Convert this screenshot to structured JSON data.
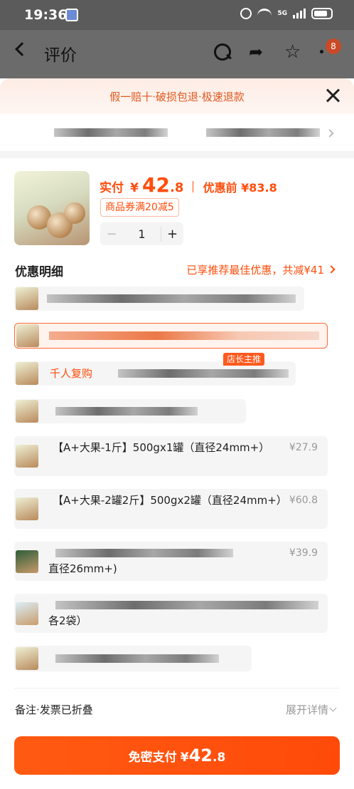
{
  "status_bar": {
    "time": "19:36",
    "network": "5G"
  },
  "header": {
    "title": "评价",
    "badge_count": "8"
  },
  "sheet": {
    "promise_text": "假一赔十·破损包退·极速退款",
    "product": {
      "price_label": "实付",
      "price_yen": "¥",
      "price_int": "42",
      "price_dec": ".8",
      "original_price": "优惠前 ¥83.8",
      "coupon": "商品券满20减5",
      "stepper_minus": "−",
      "quantity": "1",
      "stepper_plus": "+"
    },
    "discount": {
      "title": "优惠明细",
      "summary": "已享推荐最佳优惠，共减¥41"
    },
    "variants": [
      {
        "text": "",
        "price": ""
      },
      {
        "text": "",
        "price": ""
      },
      {
        "text": "千人复购",
        "badge": "店长主推",
        "price": ""
      },
      {
        "text": "",
        "price": ""
      },
      {
        "text": "【A+大果-1斤】500gx1罐（直径24mm+）",
        "price": "¥27.9"
      },
      {
        "text": "【A+大果-2罐2斤】500gx2罐（直径24mm+）",
        "price": "¥60.8"
      },
      {
        "text": "直径26mm+)",
        "price": "¥39.9"
      },
      {
        "text": "各2袋）",
        "price": ""
      },
      {
        "text": "",
        "price": ""
      }
    ],
    "remark": {
      "label": "备注·发票已折叠",
      "expand": "展开详情"
    },
    "pay": {
      "label": "免密支付",
      "yen": "¥",
      "int": "42",
      "dec": ".8"
    }
  },
  "colors": {
    "accent": "#ff4d0c",
    "status_bar_bg": "#5b5b5b",
    "overlay_header_bg": "#6b6b6b"
  }
}
